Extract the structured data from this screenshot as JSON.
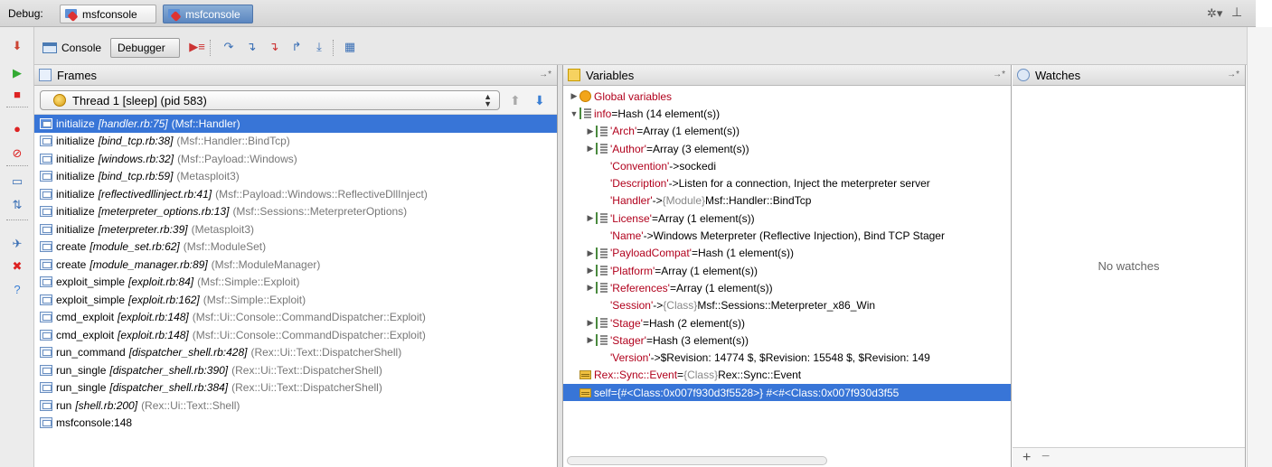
{
  "debug_bar": {
    "label": "Debug:",
    "tabs": [
      {
        "label": "msfconsole",
        "active": false
      },
      {
        "label": "msfconsole",
        "active": true
      }
    ]
  },
  "tool_tabs": {
    "console": "Console",
    "debugger": "Debugger"
  },
  "frames": {
    "title": "Frames",
    "thread": "Thread 1 [sleep] (pid 583)",
    "items": [
      {
        "name": "initialize",
        "loc": "[handler.rb:75]",
        "cls": "(Msf::Handler)"
      },
      {
        "name": "initialize",
        "loc": "[bind_tcp.rb:38]",
        "cls": "(Msf::Handler::BindTcp)"
      },
      {
        "name": "initialize",
        "loc": "[windows.rb:32]",
        "cls": "(Msf::Payload::Windows)"
      },
      {
        "name": "initialize",
        "loc": "[bind_tcp.rb:59]",
        "cls": "(Metasploit3)"
      },
      {
        "name": "initialize",
        "loc": "[reflectivedllinject.rb:41]",
        "cls": "(Msf::Payload::Windows::ReflectiveDllInject)"
      },
      {
        "name": "initialize",
        "loc": "[meterpreter_options.rb:13]",
        "cls": "(Msf::Sessions::MeterpreterOptions)"
      },
      {
        "name": "initialize",
        "loc": "[meterpreter.rb:39]",
        "cls": "(Metasploit3)"
      },
      {
        "name": "create",
        "loc": "[module_set.rb:62]",
        "cls": "(Msf::ModuleSet)"
      },
      {
        "name": "create",
        "loc": "[module_manager.rb:89]",
        "cls": "(Msf::ModuleManager)"
      },
      {
        "name": "exploit_simple",
        "loc": "[exploit.rb:84]",
        "cls": "(Msf::Simple::Exploit)"
      },
      {
        "name": "exploit_simple",
        "loc": "[exploit.rb:162]",
        "cls": "(Msf::Simple::Exploit)"
      },
      {
        "name": "cmd_exploit",
        "loc": "[exploit.rb:148]",
        "cls": "(Msf::Ui::Console::CommandDispatcher::Exploit)"
      },
      {
        "name": "cmd_exploit",
        "loc": "[exploit.rb:148]",
        "cls": "(Msf::Ui::Console::CommandDispatcher::Exploit)"
      },
      {
        "name": "run_command",
        "loc": "[dispatcher_shell.rb:428]",
        "cls": "(Rex::Ui::Text::DispatcherShell)"
      },
      {
        "name": "run_single",
        "loc": "[dispatcher_shell.rb:390]",
        "cls": "(Rex::Ui::Text::DispatcherShell)"
      },
      {
        "name": "run_single",
        "loc": "[dispatcher_shell.rb:384]",
        "cls": "(Rex::Ui::Text::DispatcherShell)"
      },
      {
        "name": "run",
        "loc": "[shell.rb:200]",
        "cls": "(Rex::Ui::Text::Shell)"
      },
      {
        "name": "msfconsole:148",
        "loc": "",
        "cls": ""
      }
    ]
  },
  "variables": {
    "title": "Variables",
    "items": [
      {
        "indent": 0,
        "tri": "▶",
        "icon": "global",
        "key": "Global variables",
        "eq": "",
        "tag": "",
        "val": ""
      },
      {
        "indent": 0,
        "tri": "▼",
        "icon": "hash",
        "key": "info",
        "eq": " = ",
        "tag": "",
        "val": "Hash (14 element(s))"
      },
      {
        "indent": 1,
        "tri": "▶",
        "icon": "hash",
        "key": "'Arch'",
        "eq": " = ",
        "tag": "",
        "val": "Array (1 element(s))"
      },
      {
        "indent": 1,
        "tri": "▶",
        "icon": "hash",
        "key": "'Author'",
        "eq": " = ",
        "tag": "",
        "val": "Array (3 element(s))"
      },
      {
        "indent": 1,
        "tri": "",
        "icon": "",
        "key": "'Convention'",
        "eq": "->",
        "tag": "",
        "val": "sockedi"
      },
      {
        "indent": 1,
        "tri": "",
        "icon": "",
        "key": "'Description'",
        "eq": "->",
        "tag": "",
        "val": "Listen for a connection, Inject the meterpreter server"
      },
      {
        "indent": 1,
        "tri": "",
        "icon": "",
        "key": "'Handler'",
        "eq": "->",
        "tag": "{Module}",
        "val": " Msf::Handler::BindTcp"
      },
      {
        "indent": 1,
        "tri": "▶",
        "icon": "hash",
        "key": "'License'",
        "eq": " = ",
        "tag": "",
        "val": "Array (1 element(s))"
      },
      {
        "indent": 1,
        "tri": "",
        "icon": "",
        "key": "'Name'",
        "eq": "->",
        "tag": "",
        "val": "Windows Meterpreter (Reflective Injection), Bind TCP Stager"
      },
      {
        "indent": 1,
        "tri": "▶",
        "icon": "hash",
        "key": "'PayloadCompat'",
        "eq": " = ",
        "tag": "",
        "val": "Hash (1 element(s))"
      },
      {
        "indent": 1,
        "tri": "▶",
        "icon": "hash",
        "key": "'Platform'",
        "eq": " = ",
        "tag": "",
        "val": "Array (1 element(s))"
      },
      {
        "indent": 1,
        "tri": "▶",
        "icon": "hash",
        "key": "'References'",
        "eq": " = ",
        "tag": "",
        "val": "Array (1 element(s))"
      },
      {
        "indent": 1,
        "tri": "",
        "icon": "",
        "key": "'Session'",
        "eq": "->",
        "tag": "{Class}",
        "val": " Msf::Sessions::Meterpreter_x86_Win"
      },
      {
        "indent": 1,
        "tri": "▶",
        "icon": "hash",
        "key": "'Stage'",
        "eq": " = ",
        "tag": "",
        "val": "Hash (2 element(s))"
      },
      {
        "indent": 1,
        "tri": "▶",
        "icon": "hash",
        "key": "'Stager'",
        "eq": " = ",
        "tag": "",
        "val": "Hash (3 element(s))"
      },
      {
        "indent": 1,
        "tri": "",
        "icon": "",
        "key": "'Version'",
        "eq": "->",
        "tag": "",
        "val": "$Revision: 14774 $, $Revision: 15548 $, $Revision: 149"
      },
      {
        "indent": 0,
        "tri": "",
        "icon": "field",
        "key": "Rex::Sync::Event",
        "eq": " = ",
        "tag": "{Class}",
        "val": " Rex::Sync::Event"
      },
      {
        "indent": 0,
        "tri": "",
        "icon": "field",
        "key": "self",
        "eq": " = ",
        "tag": "",
        "val": "{#<Class:0x007f930d3f5528>} #<#<Class:0x007f930d3f55"
      }
    ]
  },
  "watches": {
    "title": "Watches",
    "empty_text": "No watches",
    "add": "+",
    "remove": "−"
  }
}
